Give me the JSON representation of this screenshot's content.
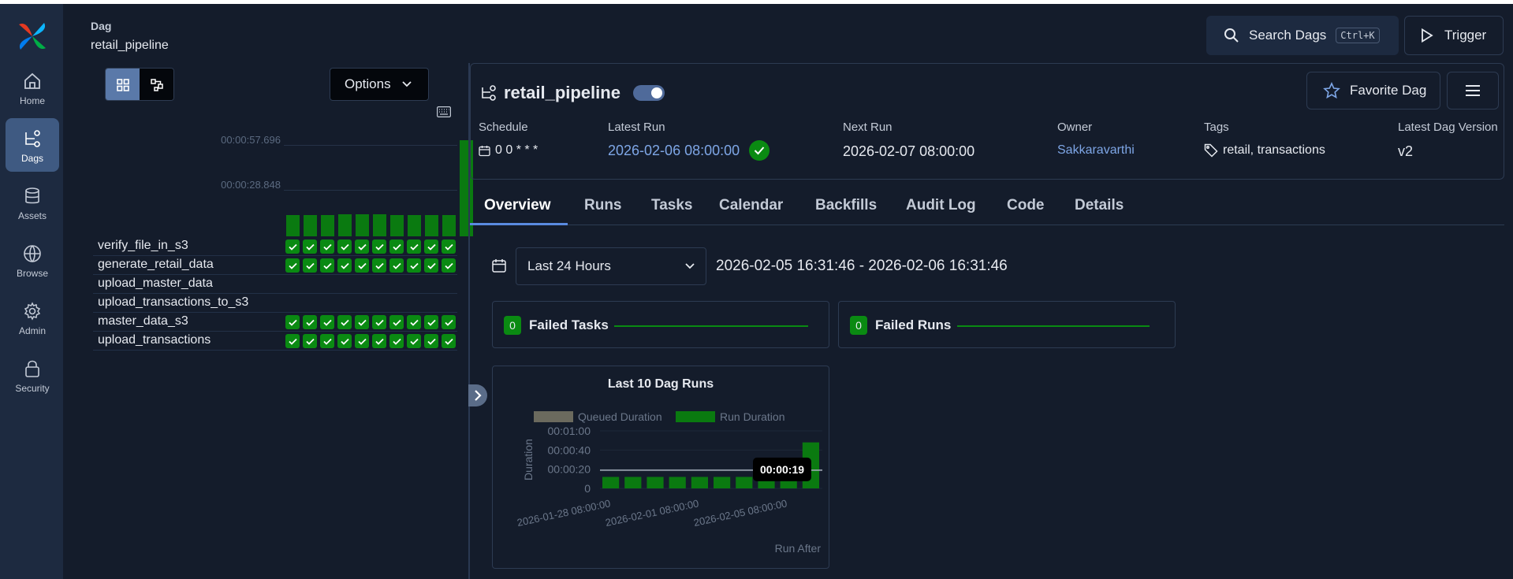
{
  "sidebar": {
    "items": [
      {
        "label": "Home",
        "icon": "home-icon"
      },
      {
        "label": "Dags",
        "icon": "dags-icon",
        "active": true
      },
      {
        "label": "Assets",
        "icon": "assets-icon"
      },
      {
        "label": "Browse",
        "icon": "globe-icon"
      },
      {
        "label": "Admin",
        "icon": "gear-icon"
      },
      {
        "label": "Security",
        "icon": "lock-icon"
      }
    ]
  },
  "left": {
    "dag_label": "Dag",
    "dag_name": "retail_pipeline",
    "options_label": "Options",
    "duration_ticks": [
      "00:00:57.696",
      "00:00:28.848"
    ],
    "grid_bars": [
      0.22,
      0.22,
      0.22,
      0.23,
      0.23,
      0.23,
      0.22,
      0.22,
      0.22,
      0.22,
      1.0
    ],
    "tasks": [
      {
        "name": "verify_file_in_s3",
        "runs": 10
      },
      {
        "name": "generate_retail_data",
        "runs": 10
      },
      {
        "name": "upload_master_data",
        "runs": 0
      },
      {
        "name": "upload_transactions_to_s3",
        "runs": 0
      },
      {
        "name": "master_data_s3",
        "runs": 10
      },
      {
        "name": "upload_transactions",
        "runs": 10
      }
    ]
  },
  "header": {
    "search_label": "Search Dags",
    "search_shortcut": "Ctrl+K",
    "trigger_label": "Trigger"
  },
  "dag": {
    "title": "retail_pipeline",
    "paused": false,
    "favorite_label": "Favorite Dag",
    "meta": {
      "schedule_key": "Schedule",
      "schedule_value": "0 0 * * *",
      "latest_run_key": "Latest Run",
      "latest_run_value": "2026-02-06 08:00:00",
      "next_run_key": "Next Run",
      "next_run_value": "2026-02-07 08:00:00",
      "owner_key": "Owner",
      "owner_value": "Sakkaravarthi",
      "tags_key": "Tags",
      "tags_value": "retail, transactions",
      "version_key": "Latest Dag Version",
      "version_value": "v2"
    }
  },
  "tabs": [
    "Overview",
    "Runs",
    "Tasks",
    "Calendar",
    "Backfills",
    "Audit Log",
    "Code",
    "Details"
  ],
  "overview": {
    "range_select": "Last 24 Hours",
    "range_text": "2026-02-05 16:31:46 - 2026-02-06 16:31:46",
    "failed_tasks": {
      "count": "0",
      "label": "Failed Tasks"
    },
    "failed_runs": {
      "count": "0",
      "label": "Failed Runs"
    }
  },
  "chart_data": {
    "type": "bar",
    "title": "Last 10 Dag Runs",
    "legend": [
      "Queued Duration",
      "Run Duration"
    ],
    "colors": {
      "queued": "#6b6a5e",
      "run": "#0a7a10"
    },
    "ylabel": "Duration",
    "xlabel": "Run After",
    "yticks": [
      "00:01:00",
      "00:00:40",
      "00:00:20",
      "0"
    ],
    "ylim": [
      0,
      60
    ],
    "xticks": [
      "2026-01-28 08:00:00",
      "2026-02-01 08:00:00",
      "2026-02-05 08:00:00"
    ],
    "series": [
      {
        "name": "Run Duration",
        "values": [
          12,
          12,
          12,
          12,
          12,
          12,
          12,
          12,
          12,
          48
        ]
      },
      {
        "name": "Queued Duration",
        "values": [
          0,
          0,
          0,
          0,
          0,
          0,
          0,
          0,
          0,
          0
        ]
      }
    ],
    "reference_line": 19,
    "tooltip": "00:00:19"
  }
}
